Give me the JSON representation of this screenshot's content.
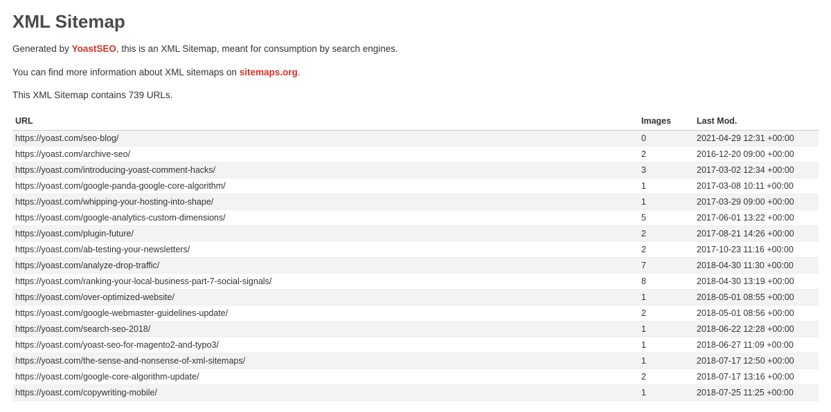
{
  "title": "XML Sitemap",
  "intro": {
    "prefix": "Generated by ",
    "brand": "YoastSEO",
    "suffix": ", this is an XML Sitemap, meant for consumption by search engines.",
    "info_prefix": "You can find more information about XML sitemaps on ",
    "info_link": "sitemaps.org",
    "info_suffix": "."
  },
  "count_text": "This XML Sitemap contains 739 URLs.",
  "headers": {
    "url": "URL",
    "images": "Images",
    "lastmod": "Last Mod."
  },
  "rows": [
    {
      "url": "https://yoast.com/seo-blog/",
      "images": "0",
      "lastmod": "2021-04-29 12:31 +00:00"
    },
    {
      "url": "https://yoast.com/archive-seo/",
      "images": "2",
      "lastmod": "2016-12-20 09:00 +00:00"
    },
    {
      "url": "https://yoast.com/introducing-yoast-comment-hacks/",
      "images": "3",
      "lastmod": "2017-03-02 12:34 +00:00"
    },
    {
      "url": "https://yoast.com/google-panda-google-core-algorithm/",
      "images": "1",
      "lastmod": "2017-03-08 10:11 +00:00"
    },
    {
      "url": "https://yoast.com/whipping-your-hosting-into-shape/",
      "images": "1",
      "lastmod": "2017-03-29 09:00 +00:00"
    },
    {
      "url": "https://yoast.com/google-analytics-custom-dimensions/",
      "images": "5",
      "lastmod": "2017-06-01 13:22 +00:00"
    },
    {
      "url": "https://yoast.com/plugin-future/",
      "images": "2",
      "lastmod": "2017-08-21 14:26 +00:00"
    },
    {
      "url": "https://yoast.com/ab-testing-your-newsletters/",
      "images": "2",
      "lastmod": "2017-10-23 11:16 +00:00"
    },
    {
      "url": "https://yoast.com/analyze-drop-traffic/",
      "images": "7",
      "lastmod": "2018-04-30 11:30 +00:00"
    },
    {
      "url": "https://yoast.com/ranking-your-local-business-part-7-social-signals/",
      "images": "8",
      "lastmod": "2018-04-30 13:19 +00:00"
    },
    {
      "url": "https://yoast.com/over-optimized-website/",
      "images": "1",
      "lastmod": "2018-05-01 08:55 +00:00"
    },
    {
      "url": "https://yoast.com/google-webmaster-guidelines-update/",
      "images": "2",
      "lastmod": "2018-05-01 08:56 +00:00"
    },
    {
      "url": "https://yoast.com/search-seo-2018/",
      "images": "1",
      "lastmod": "2018-06-22 12:28 +00:00"
    },
    {
      "url": "https://yoast.com/yoast-seo-for-magento2-and-typo3/",
      "images": "1",
      "lastmod": "2018-06-27 11:09 +00:00"
    },
    {
      "url": "https://yoast.com/the-sense-and-nonsense-of-xml-sitemaps/",
      "images": "1",
      "lastmod": "2018-07-17 12:50 +00:00"
    },
    {
      "url": "https://yoast.com/google-core-algorithm-update/",
      "images": "2",
      "lastmod": "2018-07-17 13:16 +00:00"
    },
    {
      "url": "https://yoast.com/copywriting-mobile/",
      "images": "1",
      "lastmod": "2018-07-25 11:25 +00:00"
    }
  ]
}
